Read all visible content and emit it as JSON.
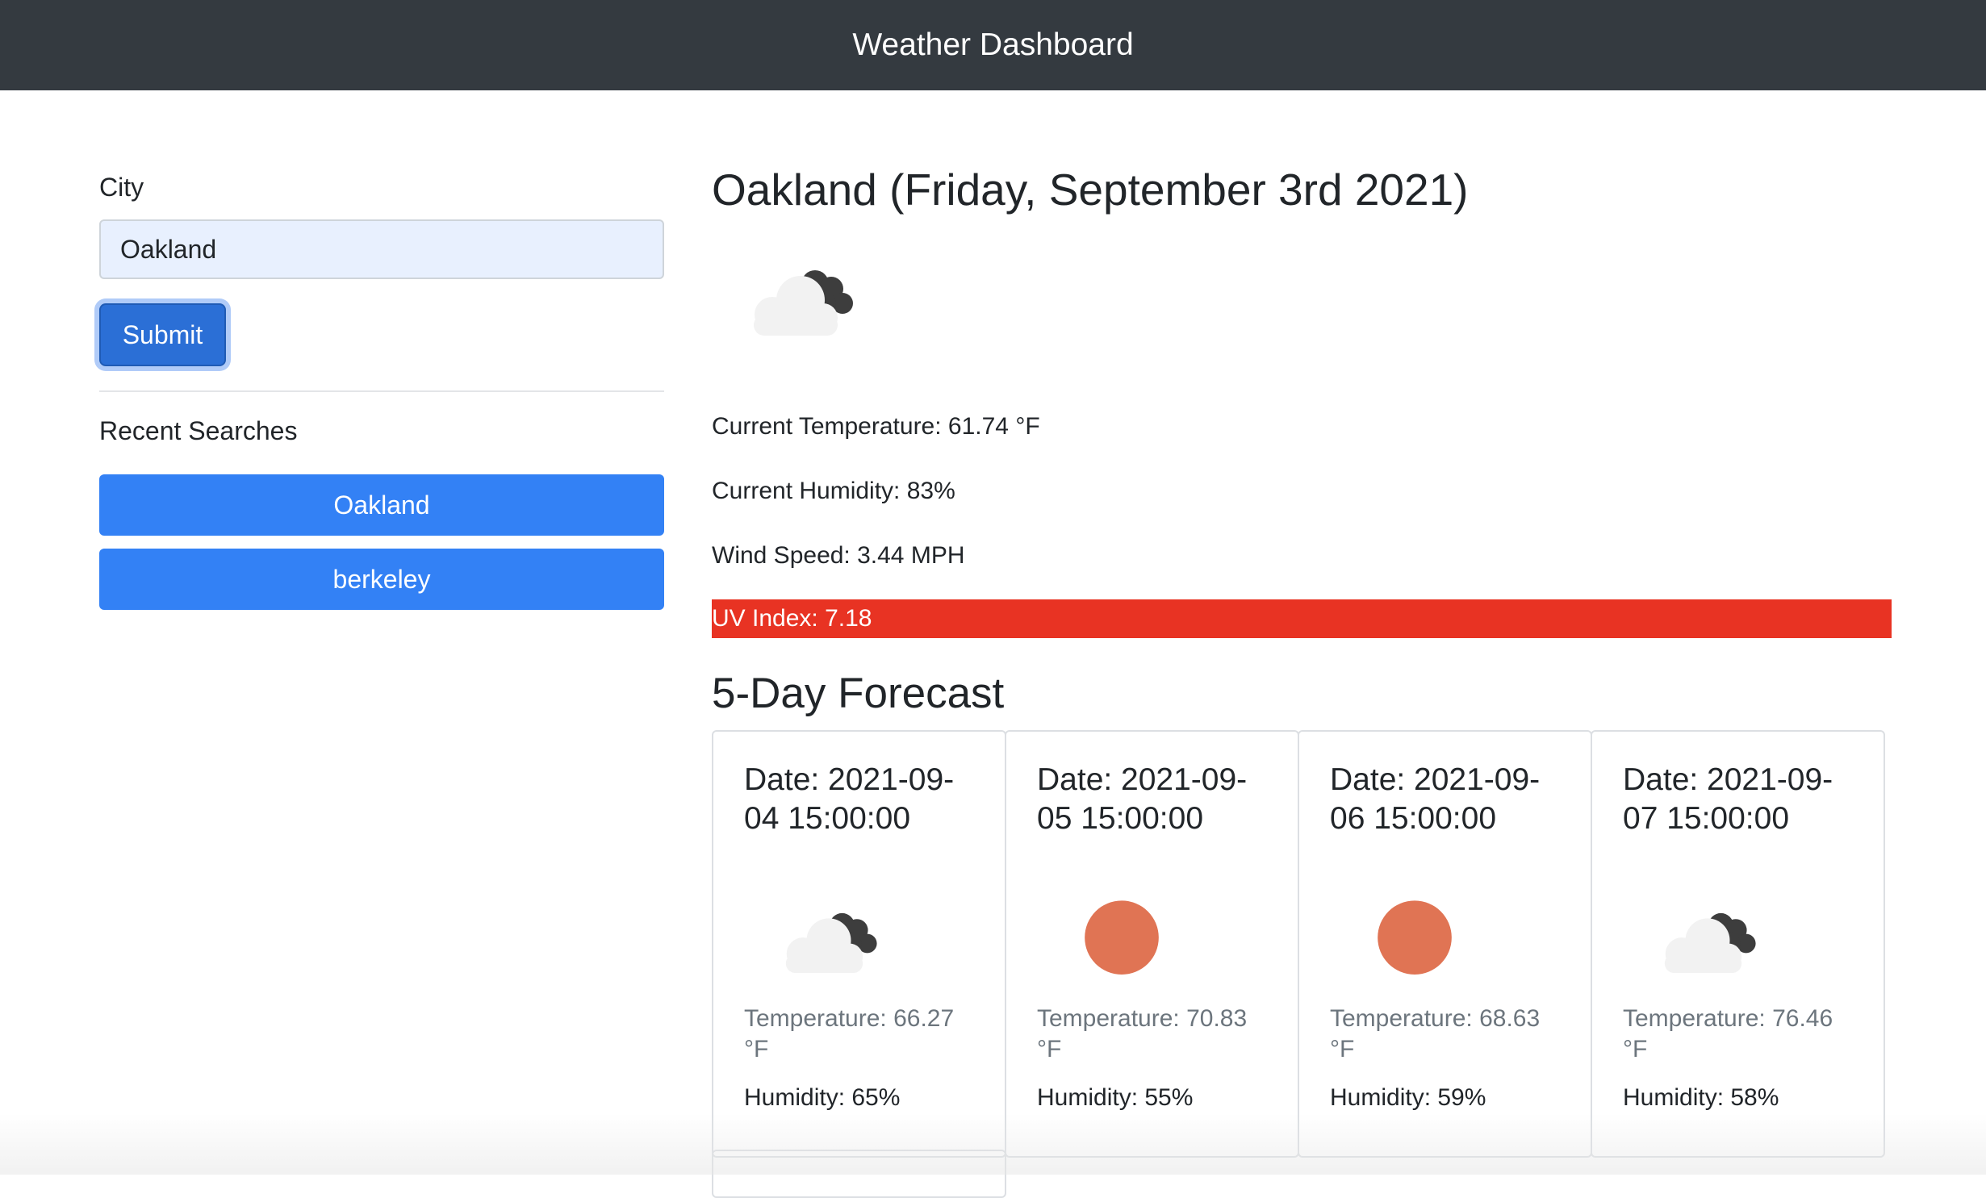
{
  "navbar": {
    "title": "Weather Dashboard"
  },
  "search": {
    "label": "City",
    "value": "Oakland",
    "submit_label": "Submit"
  },
  "recent": {
    "title": "Recent Searches",
    "items": [
      "Oakland",
      "berkeley"
    ]
  },
  "current": {
    "heading": "Oakland (Friday, September 3rd 2021)",
    "icon": "cloudy-icon",
    "temperature": "Current Temperature: 61.74 °F",
    "humidity": "Current Humidity: 83%",
    "wind": "Wind Speed: 3.44 MPH",
    "uv": "UV Index: 7.18",
    "uv_color": "#e83323"
  },
  "forecast": {
    "title": "5-Day Forecast",
    "days": [
      {
        "date": "Date: 2021-09-04 15:00:00",
        "icon": "cloudy-icon",
        "temperature": "Temperature: 66.27 °F",
        "humidity": "Humidity: 65%"
      },
      {
        "date": "Date: 2021-09-05 15:00:00",
        "icon": "sun-icon",
        "temperature": "Temperature: 70.83 °F",
        "humidity": "Humidity: 55%"
      },
      {
        "date": "Date: 2021-09-06 15:00:00",
        "icon": "sun-icon",
        "temperature": "Temperature: 68.63 °F",
        "humidity": "Humidity: 59%"
      },
      {
        "date": "Date: 2021-09-07 15:00:00",
        "icon": "cloudy-icon",
        "temperature": "Temperature: 76.46 °F",
        "humidity": "Humidity: 58%"
      }
    ]
  }
}
